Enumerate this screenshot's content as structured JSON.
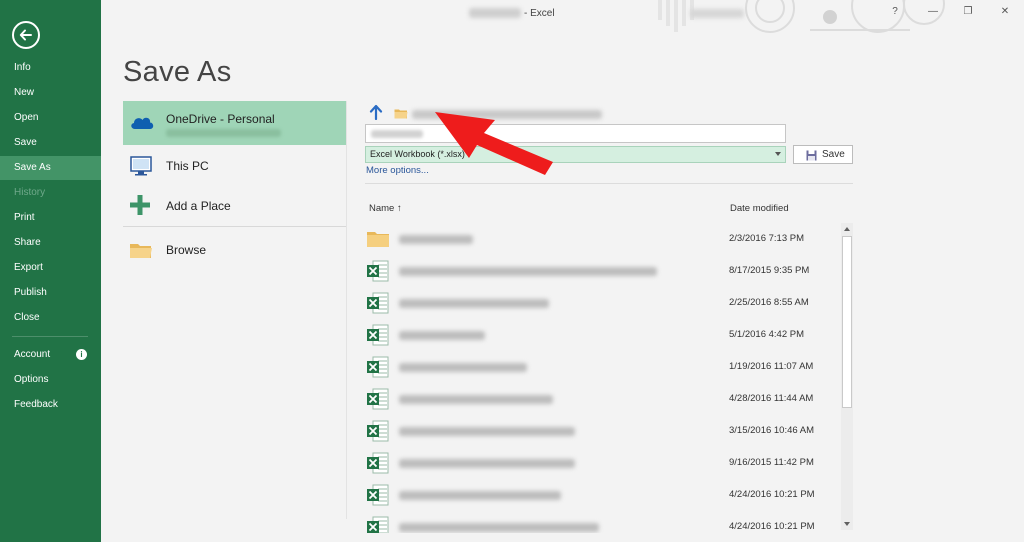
{
  "window": {
    "title_suffix": "- Excel",
    "controls": {
      "help": "?",
      "minimize": "—",
      "restore": "❐",
      "close": "✕"
    }
  },
  "nav": {
    "items": [
      {
        "label": "Info"
      },
      {
        "label": "New"
      },
      {
        "label": "Open"
      },
      {
        "label": "Save"
      },
      {
        "label": "Save As"
      },
      {
        "label": "History"
      },
      {
        "label": "Print"
      },
      {
        "label": "Share"
      },
      {
        "label": "Export"
      },
      {
        "label": "Publish"
      },
      {
        "label": "Close"
      },
      {
        "label": "Account"
      },
      {
        "label": "Options"
      },
      {
        "label": "Feedback"
      }
    ],
    "selected": "Save As",
    "info_glyph": "i"
  },
  "page": {
    "title": "Save As"
  },
  "locations": [
    {
      "label": "OneDrive - Personal",
      "icon": "cloud-icon"
    },
    {
      "label": "This PC",
      "icon": "computer-icon"
    },
    {
      "label": "Add a Place",
      "icon": "plus-icon"
    },
    {
      "label": "Browse",
      "icon": "folder-icon"
    }
  ],
  "save_panel": {
    "file_type": "Excel Workbook (*.xlsx)",
    "save_label": "Save",
    "more_options": "More options...",
    "columns": {
      "name": "Name ↑",
      "date": "Date modified"
    }
  },
  "files": [
    {
      "type": "folder",
      "date": "2/3/2016 7:13 PM"
    },
    {
      "type": "xlsx",
      "date": "8/17/2015 9:35 PM"
    },
    {
      "type": "xlsx",
      "date": "2/25/2016 8:55 AM"
    },
    {
      "type": "xlsx",
      "date": "5/1/2016 4:42 PM"
    },
    {
      "type": "xlsx",
      "date": "1/19/2016 11:07 AM"
    },
    {
      "type": "xlsx",
      "date": "4/28/2016 11:44 AM"
    },
    {
      "type": "xlsx",
      "date": "3/15/2016 10:46 AM"
    },
    {
      "type": "xlsx",
      "date": "9/16/2015 11:42 PM"
    },
    {
      "type": "xlsx",
      "date": "4/24/2016 10:21 PM"
    },
    {
      "type": "xlsx",
      "date": "4/24/2016 10:21 PM"
    }
  ],
  "colors": {
    "brand_green": "#217346",
    "nav_selected": "#439467",
    "location_selected": "#9fd5b7",
    "annotation_arrow": "#ee1c1c"
  }
}
